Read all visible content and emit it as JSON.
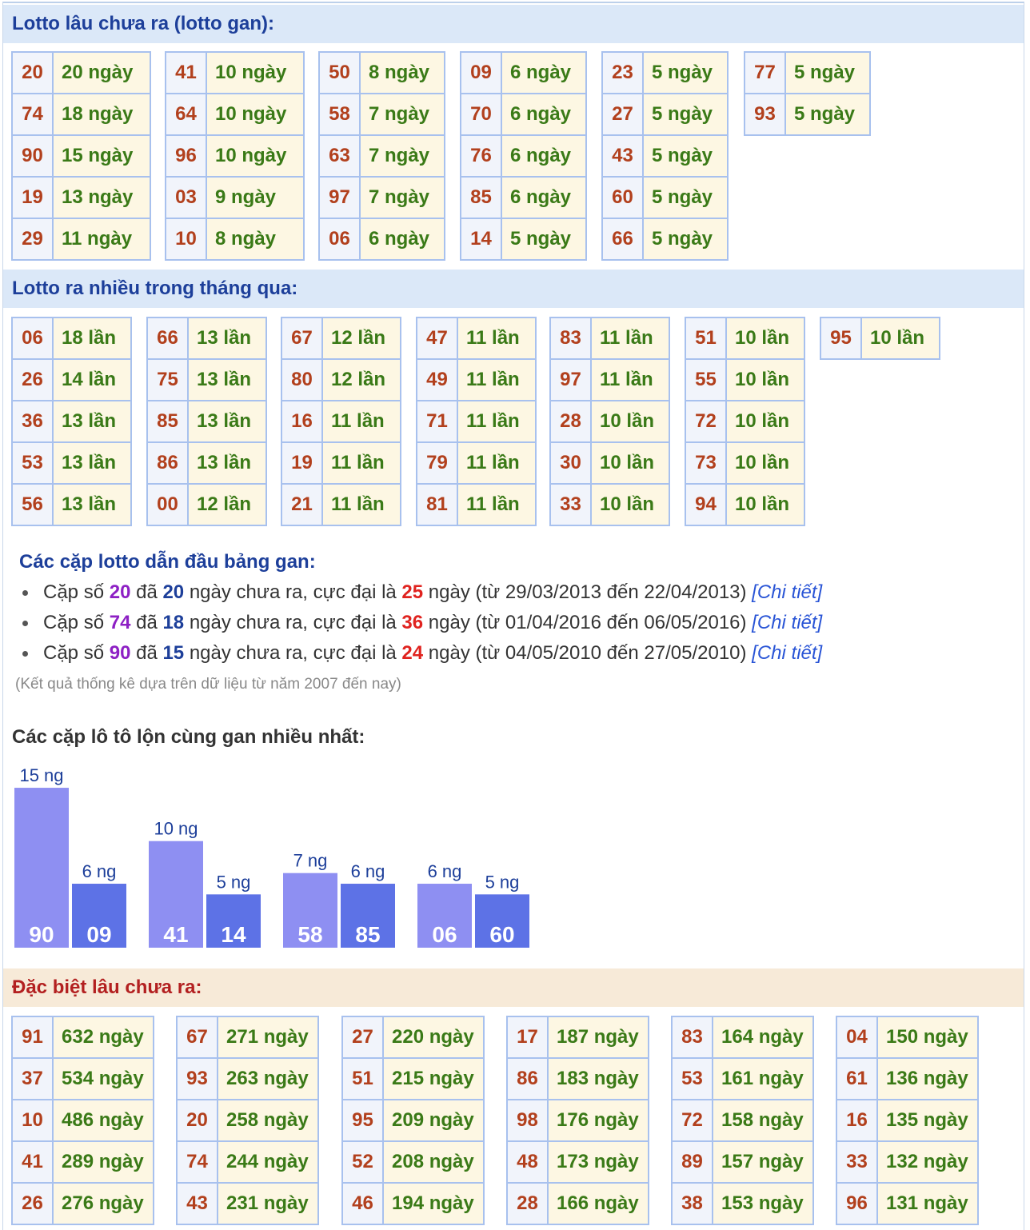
{
  "gan": {
    "title": "Lotto lâu chưa ra (lotto gan):",
    "columns": [
      [
        [
          "20",
          "20 ngày"
        ],
        [
          "74",
          "18 ngày"
        ],
        [
          "90",
          "15 ngày"
        ],
        [
          "19",
          "13 ngày"
        ],
        [
          "29",
          "11 ngày"
        ]
      ],
      [
        [
          "41",
          "10 ngày"
        ],
        [
          "64",
          "10 ngày"
        ],
        [
          "96",
          "10 ngày"
        ],
        [
          "03",
          "9 ngày"
        ],
        [
          "10",
          "8 ngày"
        ]
      ],
      [
        [
          "50",
          "8 ngày"
        ],
        [
          "58",
          "7 ngày"
        ],
        [
          "63",
          "7 ngày"
        ],
        [
          "97",
          "7 ngày"
        ],
        [
          "06",
          "6 ngày"
        ]
      ],
      [
        [
          "09",
          "6 ngày"
        ],
        [
          "70",
          "6 ngày"
        ],
        [
          "76",
          "6 ngày"
        ],
        [
          "85",
          "6 ngày"
        ],
        [
          "14",
          "5 ngày"
        ]
      ],
      [
        [
          "23",
          "5 ngày"
        ],
        [
          "27",
          "5 ngày"
        ],
        [
          "43",
          "5 ngày"
        ],
        [
          "60",
          "5 ngày"
        ],
        [
          "66",
          "5 ngày"
        ]
      ],
      [
        [
          "77",
          "5 ngày"
        ],
        [
          "93",
          "5 ngày"
        ]
      ]
    ]
  },
  "nhieu": {
    "title": "Lotto ra nhiều trong tháng qua:",
    "columns": [
      [
        [
          "06",
          "18 lần"
        ],
        [
          "26",
          "14 lần"
        ],
        [
          "36",
          "13 lần"
        ],
        [
          "53",
          "13 lần"
        ],
        [
          "56",
          "13 lần"
        ]
      ],
      [
        [
          "66",
          "13 lần"
        ],
        [
          "75",
          "13 lần"
        ],
        [
          "85",
          "13 lần"
        ],
        [
          "86",
          "13 lần"
        ],
        [
          "00",
          "12 lần"
        ]
      ],
      [
        [
          "67",
          "12 lần"
        ],
        [
          "80",
          "12 lần"
        ],
        [
          "16",
          "11 lần"
        ],
        [
          "19",
          "11 lần"
        ],
        [
          "21",
          "11 lần"
        ]
      ],
      [
        [
          "47",
          "11 lần"
        ],
        [
          "49",
          "11 lần"
        ],
        [
          "71",
          "11 lần"
        ],
        [
          "79",
          "11 lần"
        ],
        [
          "81",
          "11 lần"
        ]
      ],
      [
        [
          "83",
          "11 lần"
        ],
        [
          "97",
          "11 lần"
        ],
        [
          "28",
          "10 lần"
        ],
        [
          "30",
          "10 lần"
        ],
        [
          "33",
          "10 lần"
        ]
      ],
      [
        [
          "51",
          "10 lần"
        ],
        [
          "55",
          "10 lần"
        ],
        [
          "72",
          "10 lần"
        ],
        [
          "73",
          "10 lần"
        ],
        [
          "94",
          "10 lần"
        ]
      ],
      [
        [
          "95",
          "10 lần"
        ]
      ]
    ]
  },
  "leaders": {
    "title": "Các cặp lotto dẫn đầu bảng gan:",
    "items": [
      {
        "p1": "Cặp số ",
        "num": "20",
        "p2": " đã ",
        "days": "20",
        "p3": " ngày chưa ra, cực đại là ",
        "max": "25",
        "p4": " ngày (từ 29/03/2013 đến 22/04/2013) ",
        "link": "[Chi tiết]"
      },
      {
        "p1": "Cặp số ",
        "num": "74",
        "p2": " đã ",
        "days": "18",
        "p3": " ngày chưa ra, cực đại là ",
        "max": "36",
        "p4": " ngày (từ 01/04/2016 đến 06/05/2016) ",
        "link": "[Chi tiết]"
      },
      {
        "p1": "Cặp số ",
        "num": "90",
        "p2": " đã ",
        "days": "15",
        "p3": " ngày chưa ra, cực đại là ",
        "max": "24",
        "p4": " ngày (từ 04/05/2010 đến 27/05/2010) ",
        "link": "[Chi tiết]"
      }
    ],
    "note": "(Kết quả thống kê dựa trên dữ liệu từ năm 2007 đến nay)"
  },
  "chart_title": "Các cặp lô tô lộn cùng gan nhiều nhất:",
  "chart_data": {
    "type": "bar",
    "unit": "ng",
    "pairs": [
      [
        {
          "label": "90",
          "value": 15
        },
        {
          "label": "09",
          "value": 6
        }
      ],
      [
        {
          "label": "41",
          "value": 10
        },
        {
          "label": "14",
          "value": 5
        }
      ],
      [
        {
          "label": "58",
          "value": 7
        },
        {
          "label": "85",
          "value": 6
        }
      ],
      [
        {
          "label": "06",
          "value": 6
        },
        {
          "label": "60",
          "value": 5
        }
      ]
    ],
    "colors": {
      "first": "#8e8ff2",
      "second": "#5d72e6",
      "label": "#1d3f9a"
    }
  },
  "dacbiet": {
    "title": "Đặc biệt lâu chưa ra:",
    "columns": [
      [
        [
          "91",
          "632 ngày"
        ],
        [
          "37",
          "534 ngày"
        ],
        [
          "10",
          "486 ngày"
        ],
        [
          "41",
          "289 ngày"
        ],
        [
          "26",
          "276 ngày"
        ]
      ],
      [
        [
          "67",
          "271 ngày"
        ],
        [
          "93",
          "263 ngày"
        ],
        [
          "20",
          "258 ngày"
        ],
        [
          "74",
          "244 ngày"
        ],
        [
          "43",
          "231 ngày"
        ]
      ],
      [
        [
          "27",
          "220 ngày"
        ],
        [
          "51",
          "215 ngày"
        ],
        [
          "95",
          "209 ngày"
        ],
        [
          "52",
          "208 ngày"
        ],
        [
          "46",
          "194 ngày"
        ]
      ],
      [
        [
          "17",
          "187 ngày"
        ],
        [
          "86",
          "183 ngày"
        ],
        [
          "98",
          "176 ngày"
        ],
        [
          "48",
          "173 ngày"
        ],
        [
          "28",
          "166 ngày"
        ]
      ],
      [
        [
          "83",
          "164 ngày"
        ],
        [
          "53",
          "161 ngày"
        ],
        [
          "72",
          "158 ngày"
        ],
        [
          "89",
          "157 ngày"
        ],
        [
          "38",
          "153 ngày"
        ]
      ],
      [
        [
          "04",
          "150 ngày"
        ],
        [
          "61",
          "136 ngày"
        ],
        [
          "16",
          "135 ngày"
        ],
        [
          "33",
          "132 ngày"
        ],
        [
          "96",
          "131 ngày"
        ]
      ]
    ]
  }
}
